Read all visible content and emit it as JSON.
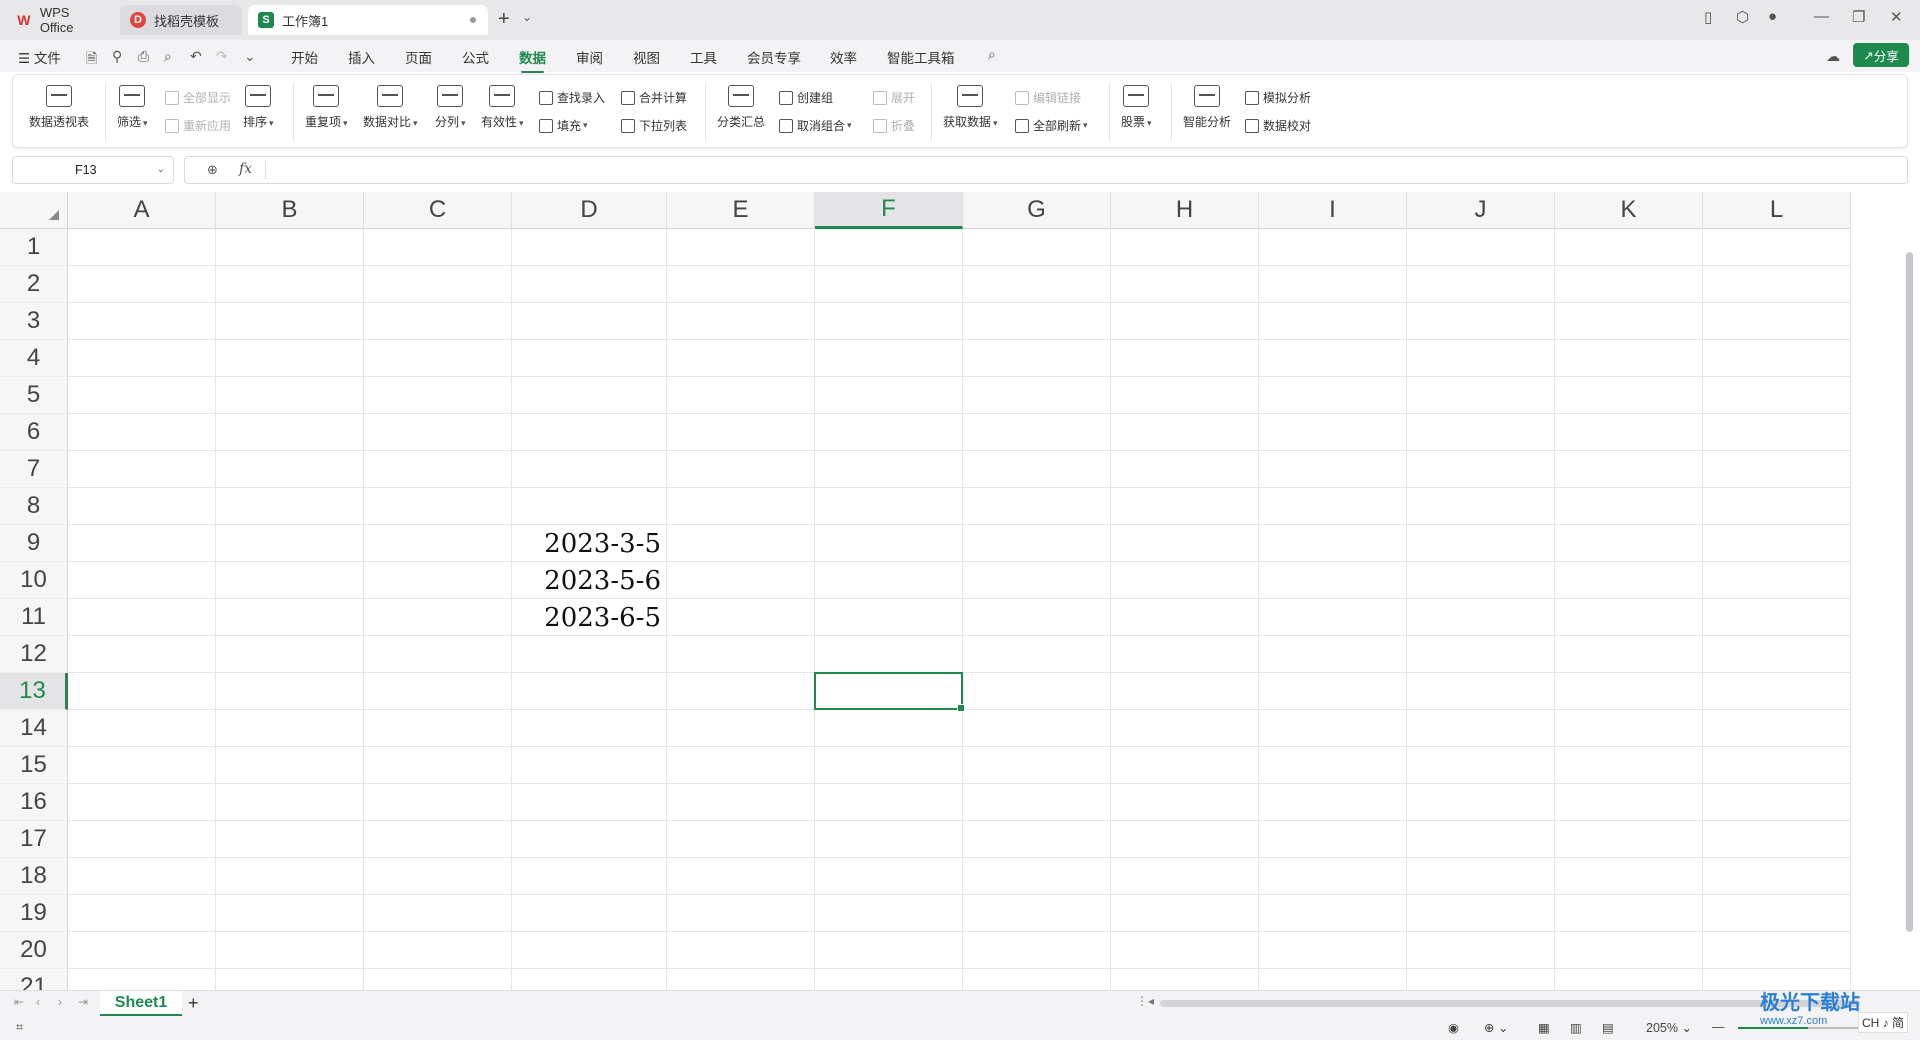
{
  "tabs": [
    {
      "label": "WPS Office",
      "icon": "wps-logo-icon"
    },
    {
      "label": "找稻壳模板",
      "icon": "docer-icon"
    },
    {
      "label": "工作簿1",
      "icon": "spreadsheet-s-icon"
    }
  ],
  "menu": {
    "file": "文件",
    "items": [
      "开始",
      "插入",
      "页面",
      "公式",
      "数据",
      "审阅",
      "视图",
      "工具",
      "会员专享",
      "效率",
      "智能工具箱"
    ],
    "active": "数据",
    "share": "分享"
  },
  "ribbon": {
    "pivot": "数据透视表",
    "filter": "筛选",
    "show_all": "全部显示",
    "reapply": "重新应用",
    "sort": "排序",
    "duplicates": "重复项",
    "compare": "数据对比",
    "split": "分列",
    "validity": "有效性",
    "lookup_entry": "查找录入",
    "fill": "填充",
    "consolidate": "合并计算",
    "dropdown_list": "下拉列表",
    "subtotal": "分类汇总",
    "group": "创建组",
    "ungroup": "取消组合",
    "expand": "展开",
    "collapse": "折叠",
    "get_data": "获取数据",
    "edit_links": "编辑链接",
    "refresh_all": "全部刷新",
    "stocks": "股票",
    "smart_analysis": "智能分析",
    "what_if": "模拟分析",
    "data_check": "数据校对"
  },
  "formula_bar": {
    "name_box": "F13",
    "fx": "fx",
    "content": ""
  },
  "grid": {
    "columns": [
      "A",
      "B",
      "C",
      "D",
      "E",
      "F",
      "G",
      "H",
      "I",
      "J",
      "K",
      "L"
    ],
    "rows": [
      "1",
      "2",
      "3",
      "4",
      "5",
      "6",
      "7",
      "8",
      "9",
      "10",
      "11",
      "12",
      "13",
      "14",
      "15",
      "16",
      "17",
      "18",
      "19",
      "20",
      "21"
    ],
    "selected_cell": "F13",
    "cells": {
      "D9": "2023-3-5",
      "D10": "2023-5-6",
      "D11": "2023-6-5"
    }
  },
  "sheets": {
    "active": "Sheet1",
    "add": "+"
  },
  "status": {
    "zoom": "205%"
  },
  "colors": {
    "accent": "#1e8a4e",
    "selection": "#1e8a4e"
  },
  "watermark": {
    "title": "极光下载站",
    "sub": "www.xz7.com"
  },
  "ime": "CH ♪ 简"
}
